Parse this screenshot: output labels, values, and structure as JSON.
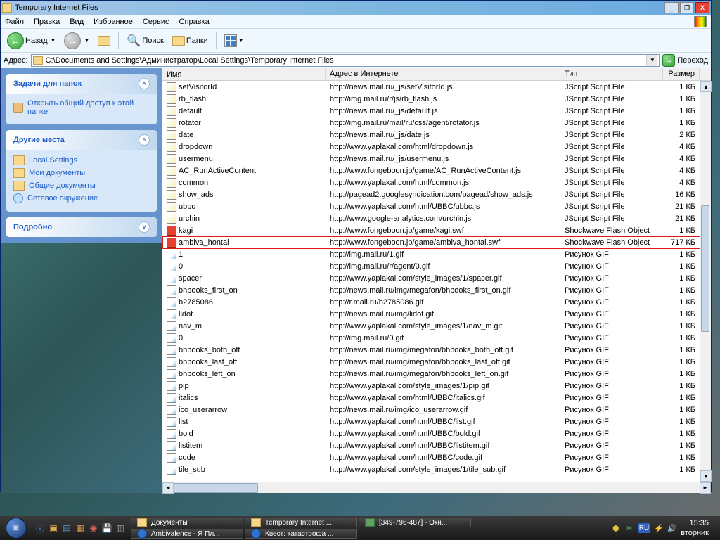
{
  "window": {
    "title": "Temporary Internet Files",
    "min": "_",
    "max": "❐",
    "close": "X"
  },
  "menu": [
    "Файл",
    "Правка",
    "Вид",
    "Избранное",
    "Сервис",
    "Справка"
  ],
  "toolbar": {
    "back": "Назад",
    "search": "Поиск",
    "folders": "Папки"
  },
  "address": {
    "label": "Адрес:",
    "path": "C:\\Documents and Settings\\Администратор\\Local Settings\\Temporary Internet Files",
    "go": "Переход"
  },
  "sidebar": {
    "tasks_head": "Задачи для папок",
    "share": "Открыть общий доступ к этой папке",
    "places_head": "Другие места",
    "places": [
      "Local Settings",
      "Мои документы",
      "Общие документы",
      "Сетевое окружение"
    ],
    "details_head": "Подробно"
  },
  "columns": {
    "name": "Имя",
    "url": "Адрес в Интернете",
    "type": "Тип",
    "size": "Размер"
  },
  "files": [
    {
      "i": "js",
      "n": "setVisitorId",
      "u": "http://news.mail.ru/_js/setVisitorId.js",
      "t": "JScript Script File",
      "s": "1 КБ"
    },
    {
      "i": "js",
      "n": "rb_flash",
      "u": "http://img.mail.ru/r/js/rb_flash.js",
      "t": "JScript Script File",
      "s": "1 КБ"
    },
    {
      "i": "js",
      "n": "default",
      "u": "http://news.mail.ru/_js/default.js",
      "t": "JScript Script File",
      "s": "1 КБ"
    },
    {
      "i": "js",
      "n": "rotator",
      "u": "http://img.mail.ru/mail/ru/css/agent/rotator.js",
      "t": "JScript Script File",
      "s": "1 КБ"
    },
    {
      "i": "js",
      "n": "date",
      "u": "http://news.mail.ru/_js/date.js",
      "t": "JScript Script File",
      "s": "2 КБ"
    },
    {
      "i": "js",
      "n": "dropdown",
      "u": "http://www.yaplakal.com/html/dropdown.js",
      "t": "JScript Script File",
      "s": "4 КБ"
    },
    {
      "i": "js",
      "n": "usermenu",
      "u": "http://news.mail.ru/_js/usermenu.js",
      "t": "JScript Script File",
      "s": "4 КБ"
    },
    {
      "i": "js",
      "n": "AC_RunActiveContent",
      "u": "http://www.fongeboon.jp/game/AC_RunActiveContent.js",
      "t": "JScript Script File",
      "s": "4 КБ"
    },
    {
      "i": "js",
      "n": "common",
      "u": "http://www.yaplakal.com/html/common.js",
      "t": "JScript Script File",
      "s": "4 КБ"
    },
    {
      "i": "js",
      "n": "show_ads",
      "u": "http://pagead2.googlesyndication.com/pagead/show_ads.js",
      "t": "JScript Script File",
      "s": "16 КБ"
    },
    {
      "i": "js",
      "n": "ubbc",
      "u": "http://www.yaplakal.com/html/UBBC/ubbc.js",
      "t": "JScript Script File",
      "s": "21 КБ"
    },
    {
      "i": "js",
      "n": "urchin",
      "u": "http://www.google-analytics.com/urchin.js",
      "t": "JScript Script File",
      "s": "21 КБ"
    },
    {
      "i": "swf",
      "n": "kagi",
      "u": "http://www.fongeboon.jp/game/kagi.swf",
      "t": "Shockwave Flash Object",
      "s": "1 КБ"
    },
    {
      "i": "swf",
      "n": "ambiva_hontai",
      "u": "http://www.fongeboon.jp/game/ambiva_hontai.swf",
      "t": "Shockwave Flash Object",
      "s": "717 КБ",
      "hl": true
    },
    {
      "i": "gif",
      "n": "1",
      "u": "http://img.mail.ru/1.gif",
      "t": "Рисунок GIF",
      "s": "1 КБ"
    },
    {
      "i": "gif",
      "n": "0",
      "u": "http://img.mail.ru/r/agent/0.gif",
      "t": "Рисунок GIF",
      "s": "1 КБ"
    },
    {
      "i": "gif",
      "n": "spacer",
      "u": "http://www.yaplakal.com/style_images/1/spacer.gif",
      "t": "Рисунок GIF",
      "s": "1 КБ"
    },
    {
      "i": "gif",
      "n": "bhbooks_first_on",
      "u": "http://news.mail.ru/img/megafon/bhbooks_first_on.gif",
      "t": "Рисунок GIF",
      "s": "1 КБ"
    },
    {
      "i": "gif",
      "n": "b2785086",
      "u": "http://r.mail.ru/b2785086.gif",
      "t": "Рисунок GIF",
      "s": "1 КБ"
    },
    {
      "i": "gif",
      "n": "lidot",
      "u": "http://news.mail.ru/img/lidot.gif",
      "t": "Рисунок GIF",
      "s": "1 КБ"
    },
    {
      "i": "gif",
      "n": "nav_m",
      "u": "http://www.yaplakal.com/style_images/1/nav_m.gif",
      "t": "Рисунок GIF",
      "s": "1 КБ"
    },
    {
      "i": "gif",
      "n": "0",
      "u": "http://img.mail.ru/0.gif",
      "t": "Рисунок GIF",
      "s": "1 КБ"
    },
    {
      "i": "gif",
      "n": "bhbooks_both_off",
      "u": "http://news.mail.ru/img/megafon/bhbooks_both_off.gif",
      "t": "Рисунок GIF",
      "s": "1 КБ"
    },
    {
      "i": "gif",
      "n": "bhbooks_last_off",
      "u": "http://news.mail.ru/img/megafon/bhbooks_last_off.gif",
      "t": "Рисунок GIF",
      "s": "1 КБ"
    },
    {
      "i": "gif",
      "n": "bhbooks_left_on",
      "u": "http://news.mail.ru/img/megafon/bhbooks_left_on.gif",
      "t": "Рисунок GIF",
      "s": "1 КБ"
    },
    {
      "i": "gif",
      "n": "pip",
      "u": "http://www.yaplakal.com/style_images/1/pip.gif",
      "t": "Рисунок GIF",
      "s": "1 КБ"
    },
    {
      "i": "gif",
      "n": "italics",
      "u": "http://www.yaplakal.com/html/UBBC/italics.gif",
      "t": "Рисунок GIF",
      "s": "1 КБ"
    },
    {
      "i": "gif",
      "n": "ico_userarrow",
      "u": "http://news.mail.ru/img/ico_userarrow.gif",
      "t": "Рисунок GIF",
      "s": "1 КБ"
    },
    {
      "i": "gif",
      "n": "list",
      "u": "http://www.yaplakal.com/html/UBBC/list.gif",
      "t": "Рисунок GIF",
      "s": "1 КБ"
    },
    {
      "i": "gif",
      "n": "bold",
      "u": "http://www.yaplakal.com/html/UBBC/bold.gif",
      "t": "Рисунок GIF",
      "s": "1 КБ"
    },
    {
      "i": "gif",
      "n": "listitem",
      "u": "http://www.yaplakal.com/html/UBBC/listitem.gif",
      "t": "Рисунок GIF",
      "s": "1 КБ"
    },
    {
      "i": "gif",
      "n": "code",
      "u": "http://www.yaplakal.com/html/UBBC/code.gif",
      "t": "Рисунок GIF",
      "s": "1 КБ"
    },
    {
      "i": "gif",
      "n": "tile_sub",
      "u": "http://www.yaplakal.com/style_images/1/tile_sub.gif",
      "t": "Рисунок GIF",
      "s": "1 КБ"
    }
  ],
  "taskbar": {
    "btns": [
      {
        "cls": "",
        "ico": "folder",
        "label": "Документы"
      },
      {
        "cls": "",
        "ico": "folder",
        "label": "Temporary Internet ..."
      },
      {
        "cls": "gm",
        "ico": "gm",
        "label": "[349-796-487] - Окн..."
      },
      {
        "cls": "ie",
        "ico": "ie",
        "label": "Ambivalence - Я Пл..."
      },
      {
        "cls": "ie",
        "ico": "ie",
        "label": "Квест: катастрофа ..."
      }
    ],
    "lang": "RU",
    "time": "15:35",
    "day": "вторник"
  }
}
